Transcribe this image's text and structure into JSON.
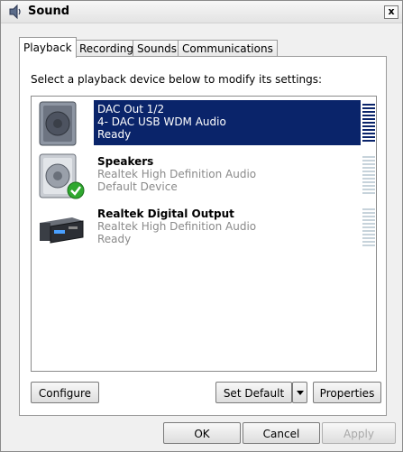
{
  "window": {
    "title": "Sound",
    "close_label": "x"
  },
  "tabs": [
    {
      "label": "Playback",
      "active": true
    },
    {
      "label": "Recording",
      "active": false
    },
    {
      "label": "Sounds",
      "active": false
    },
    {
      "label": "Communications",
      "active": false
    }
  ],
  "instruction": "Select a playback device below to modify its settings:",
  "devices": [
    {
      "name": "DAC Out 1/2",
      "driver": "4- DAC USB WDM Audio",
      "status": "Ready",
      "icon": "speaker-icon",
      "selected": true,
      "default": false
    },
    {
      "name": "Speakers",
      "driver": "Realtek High Definition Audio",
      "status": "Default Device",
      "icon": "speaker-icon",
      "selected": false,
      "default": true
    },
    {
      "name": "Realtek Digital Output",
      "driver": "Realtek High Definition Audio",
      "status": "Ready",
      "icon": "receiver-icon",
      "selected": false,
      "default": false
    }
  ],
  "buttons": {
    "configure": "Configure",
    "set_default": "Set Default",
    "properties": "Properties",
    "ok": "OK",
    "cancel": "Cancel",
    "apply": "Apply"
  },
  "colors": {
    "selection": "#0a246a",
    "default_check": "#2fa82f"
  }
}
